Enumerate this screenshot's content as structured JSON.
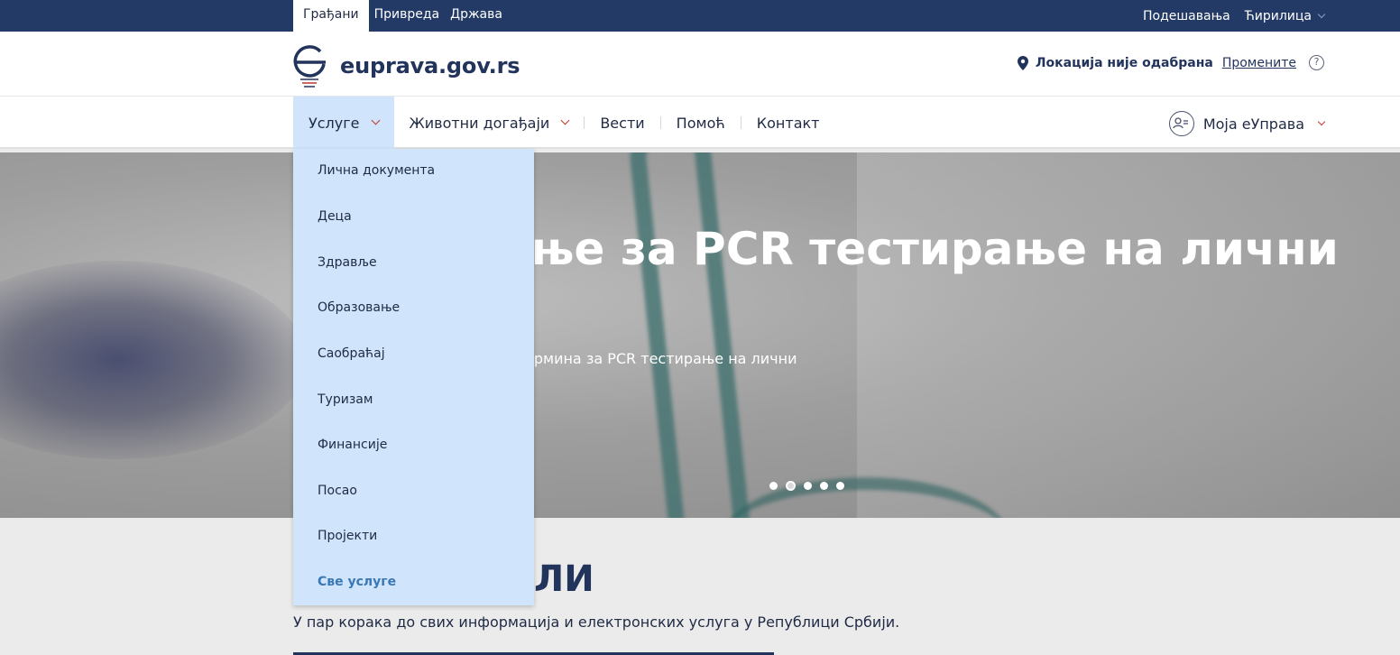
{
  "topbar": {
    "tabs": [
      "Грађани",
      "Привреда",
      "Држава"
    ],
    "settings": "Подешавања",
    "language": "Ћирилица"
  },
  "header": {
    "logo_text": "euprava.gov.rs",
    "location_label": "Локација није одабрана",
    "location_change": "Промените",
    "help_symbol": "?"
  },
  "nav": {
    "items": [
      "Услуге",
      "Животни догађаји",
      "Вести",
      "Помоћ",
      "Контакт"
    ],
    "account": "Моја еУправа"
  },
  "hero": {
    "title": "ање за PCR тестирање на лични",
    "subtitle": "ермина за PCR тестирање на лични",
    "slides_count": 5,
    "active_slide": 2
  },
  "dropdown": {
    "items": [
      "Лична документа",
      "Деца",
      "Здравље",
      "Образовање",
      "Саобраћај",
      "Туризам",
      "Финансије",
      "Посао",
      "Пројекти"
    ],
    "all_services": "Све услуге"
  },
  "lower": {
    "title": "ЛИ",
    "description": "У пар корака до свих информација и електронских услуга у Републици Србији."
  },
  "colors": {
    "topbar_bg": "#243a66",
    "brand_dark": "#23345c",
    "dropdown_bg": "#d0e4fb",
    "accent_red": "#c0392b",
    "link_blue": "#3a78b5"
  }
}
